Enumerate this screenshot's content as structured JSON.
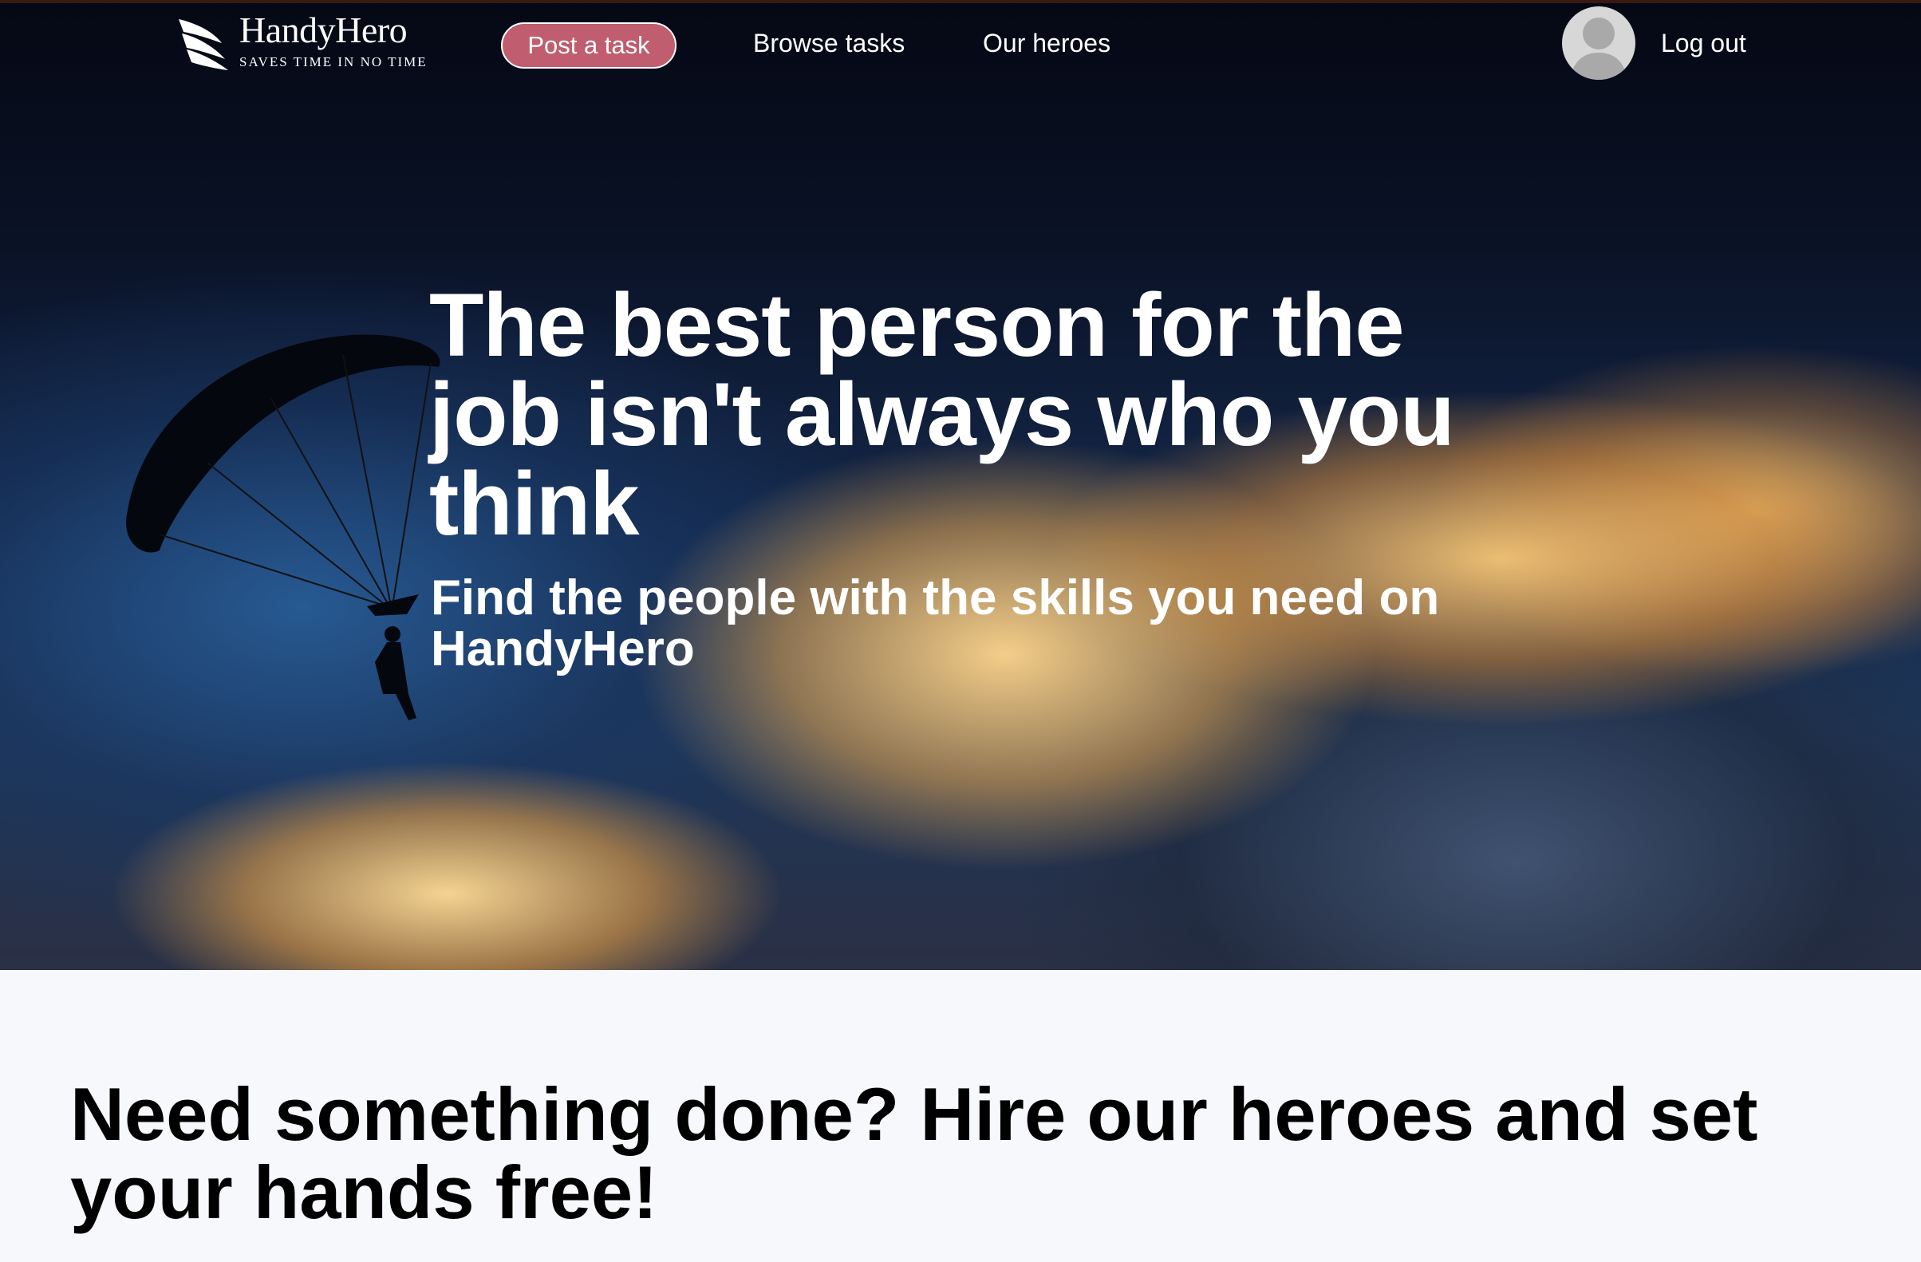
{
  "nav": {
    "logo": {
      "name": "HandyHero",
      "tagline": "SAVES TIME IN NO TIME"
    },
    "post_task_label": "Post a task",
    "browse_label": "Browse tasks",
    "heroes_label": "Our heroes",
    "logout_label": "Log out"
  },
  "hero": {
    "title": "The best person for the job isn't always who you think",
    "subtitle": "Find the people with the skills you need on HandyHero"
  },
  "section": {
    "title": "Need something done? Hire our heroes and set your hands free!"
  },
  "colors": {
    "accent": "#c05d6f",
    "section_bg": "#f7f8fc",
    "hero_text": "#ffffff"
  },
  "icons": {
    "logo": "winged-logo-icon",
    "avatar": "user-avatar-icon",
    "parachute": "parachute-image"
  }
}
